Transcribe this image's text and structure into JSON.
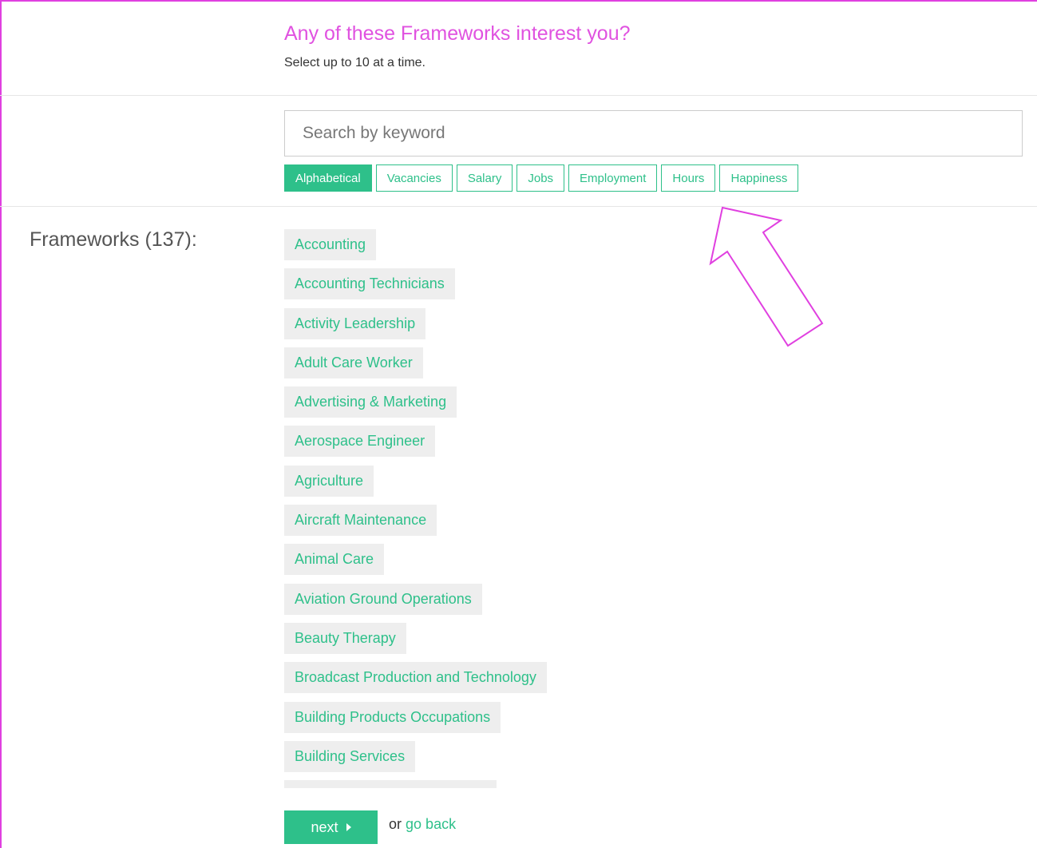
{
  "header": {
    "title": "Any of these Frameworks interest you?",
    "subtitle": "Select up to 10 at a time."
  },
  "search": {
    "placeholder": "Search by keyword",
    "value": ""
  },
  "sort_tabs": [
    {
      "label": "Alphabetical",
      "active": true
    },
    {
      "label": "Vacancies",
      "active": false
    },
    {
      "label": "Salary",
      "active": false
    },
    {
      "label": "Jobs",
      "active": false
    },
    {
      "label": "Employment",
      "active": false
    },
    {
      "label": "Hours",
      "active": false
    },
    {
      "label": "Happiness",
      "active": false
    }
  ],
  "frameworks": {
    "label": "Frameworks (137):",
    "items": [
      "Accounting",
      "Accounting Technicians",
      "Activity Leadership",
      "Adult Care Worker",
      "Advertising & Marketing",
      "Aerospace Engineer",
      "Agriculture",
      "Aircraft Maintenance",
      "Animal Care",
      "Aviation Ground Operations",
      "Beauty Therapy",
      "Broadcast Production and Technology",
      "Building Products Occupations",
      "Building Services"
    ]
  },
  "footer": {
    "next_label": "next",
    "or_text": "or",
    "back_label": "go back"
  },
  "colors": {
    "accent": "#2ec08a",
    "title": "#e052e0",
    "annotation": "#e040e0"
  }
}
